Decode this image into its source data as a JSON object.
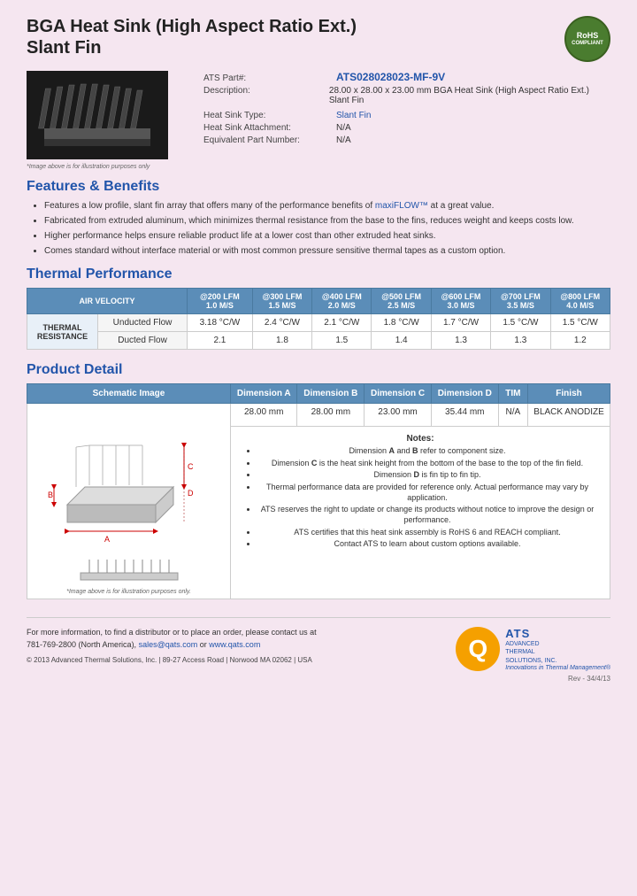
{
  "header": {
    "title_line1": "BGA Heat Sink (High Aspect Ratio Ext.)",
    "title_line2": "Slant Fin",
    "rohs": {
      "line1": "RoHS",
      "line2": "COMPLIANT"
    }
  },
  "product": {
    "ats_part_label": "ATS Part#:",
    "ats_part_value": "ATS028028023-MF-9V",
    "description_label": "Description:",
    "description_value": "28.00 x 28.00 x 23.00 mm BGA Heat Sink (High Aspect Ratio Ext.) Slant Fin",
    "heat_sink_type_label": "Heat Sink Type:",
    "heat_sink_type_value": "Slant Fin",
    "heat_sink_attachment_label": "Heat Sink Attachment:",
    "heat_sink_attachment_value": "N/A",
    "equivalent_part_label": "Equivalent Part Number:",
    "equivalent_part_value": "N/A",
    "image_caption": "*Image above is for illustration purposes only"
  },
  "features": {
    "section_title": "Features & Benefits",
    "items": [
      "Features a low profile, slant fin array that offers many of the performance benefits of maxiFLOW™ at a great value.",
      "Fabricated from extruded aluminum, which minimizes thermal resistance from the base to the fins, reduces weight and keeps costs low.",
      "Higher performance helps ensure reliable product life at a lower cost than other extruded heat sinks.",
      "Comes standard without interface material or with most common pressure sensitive thermal tapes as a custom option."
    ],
    "highlight_text": "maxiFLOW™"
  },
  "thermal_performance": {
    "section_title": "Thermal Performance",
    "table": {
      "header_label": "AIR VELOCITY",
      "columns": [
        {
          "label": "@200 LFM",
          "sub": "1.0 M/S"
        },
        {
          "label": "@300 LFM",
          "sub": "1.5 M/S"
        },
        {
          "label": "@400 LFM",
          "sub": "2.0 M/S"
        },
        {
          "label": "@500 LFM",
          "sub": "2.5 M/S"
        },
        {
          "label": "@600 LFM",
          "sub": "3.0 M/S"
        },
        {
          "label": "@700 LFM",
          "sub": "3.5 M/S"
        },
        {
          "label": "@800 LFM",
          "sub": "4.0 M/S"
        }
      ],
      "row_label": "THERMAL RESISTANCE",
      "rows": [
        {
          "sub_label": "Unducted Flow",
          "values": [
            "3.18 °C/W",
            "2.4 °C/W",
            "2.1 °C/W",
            "1.8 °C/W",
            "1.7 °C/W",
            "1.5 °C/W",
            "1.5 °C/W"
          ]
        },
        {
          "sub_label": "Ducted Flow",
          "values": [
            "2.1",
            "1.8",
            "1.5",
            "1.4",
            "1.3",
            "1.3",
            "1.2"
          ]
        }
      ]
    }
  },
  "product_detail": {
    "section_title": "Product Detail",
    "table_headers": [
      "Schematic Image",
      "Dimension A",
      "Dimension B",
      "Dimension C",
      "Dimension D",
      "TIM",
      "Finish"
    ],
    "dimension_values": [
      "28.00 mm",
      "28.00 mm",
      "23.00 mm",
      "35.44 mm",
      "N/A",
      "BLACK ANODIZE"
    ],
    "schematic_caption": "*Image above is for illustration purposes only.",
    "notes_title": "Notes:",
    "notes": [
      "Dimension A and B refer to component size.",
      "Dimension C is the heat sink height from the bottom of the base to the top of the fin field.",
      "Dimension D is fin tip to fin tip.",
      "Thermal performance data are provided for reference only. Actual performance may vary by application.",
      "ATS reserves the right to update or change its products without notice to improve the design or performance.",
      "ATS certifies that this heat sink assembly is RoHS 6 and REACH compliant.",
      "Contact ATS to learn about custom options available."
    ]
  },
  "footer": {
    "contact_text": "For more information, to find a distributor or to place an order, please contact us at",
    "phone": "781-769-2800 (North America),",
    "email": "sales@qats.com",
    "or_text": "or",
    "website": "www.qats.com",
    "copyright": "© 2013 Advanced Thermal Solutions, Inc.  |  89-27 Access Road  |  Norwood MA  02062  |  USA",
    "logo": {
      "q_letter": "Q",
      "ats_letters": "ATS",
      "company_name_line1": "ADVANCED",
      "company_name_line2": "THERMAL",
      "company_name_line3": "SOLUTIONS, INC.",
      "tagline": "Innovations in Thermal Management®"
    },
    "page_number": "Rev - 34/4/13"
  }
}
